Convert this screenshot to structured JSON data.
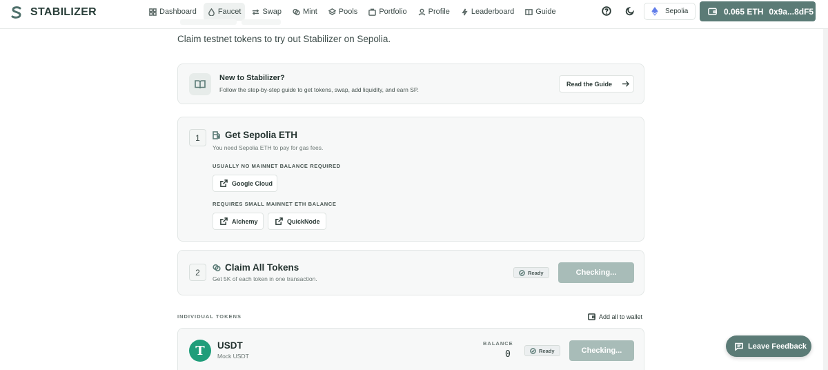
{
  "app": {
    "name": "STABILIZER"
  },
  "nav": [
    {
      "label": "Dashboard",
      "icon": "dashboard-icon"
    },
    {
      "label": "Faucet",
      "icon": "droplet-icon",
      "active": true
    },
    {
      "label": "Swap",
      "icon": "swap-icon"
    },
    {
      "label": "Mint",
      "icon": "mint-icon"
    },
    {
      "label": "Pools",
      "icon": "layers-icon"
    },
    {
      "label": "Portfolio",
      "icon": "briefcase-icon"
    },
    {
      "label": "Profile",
      "icon": "user-icon"
    },
    {
      "label": "Leaderboard",
      "icon": "trophy-icon"
    },
    {
      "label": "Guide",
      "icon": "book-icon"
    }
  ],
  "header": {
    "network": "Sepolia",
    "wallet_balance": "0.065 ETH",
    "wallet_address": "0x9a...8dF5"
  },
  "page": {
    "subtitle": "Claim testnet tokens to try out Stabilizer on Sepolia."
  },
  "guide_card": {
    "title": "New to Stabilizer?",
    "description": "Follow the step-by-step guide to get tokens, swap, add liquidity, and earn SP.",
    "button": "Read the Guide"
  },
  "step1": {
    "number": "1",
    "title": "Get Sepolia ETH",
    "description": "You need Sepolia ETH to pay for gas fees.",
    "section_a": "USUALLY NO MAINNET BALANCE REQUIRED",
    "section_b": "REQUIRES SMALL MAINNET ETH BALANCE",
    "links": [
      "Google Cloud",
      "Alchemy",
      "QuickNode"
    ]
  },
  "step2": {
    "number": "2",
    "title": "Claim All Tokens",
    "description": "Get 5K of each token in one transaction.",
    "badge": "Ready",
    "button": "Checking..."
  },
  "individual": {
    "label": "INDIVIDUAL TOKENS",
    "add_all": "Add all to wallet"
  },
  "token": {
    "logo": "T",
    "symbol": "USDT",
    "name": "Mock USDT",
    "balance_label": "BALANCE",
    "balance": "0",
    "badge": "Ready",
    "button": "Checking..."
  },
  "feedback": {
    "label": "Leave Feedback"
  },
  "colors": {
    "accent": "#5b7b76",
    "usdt": "#1f9d7a",
    "disabled": "#a8bcb8"
  }
}
